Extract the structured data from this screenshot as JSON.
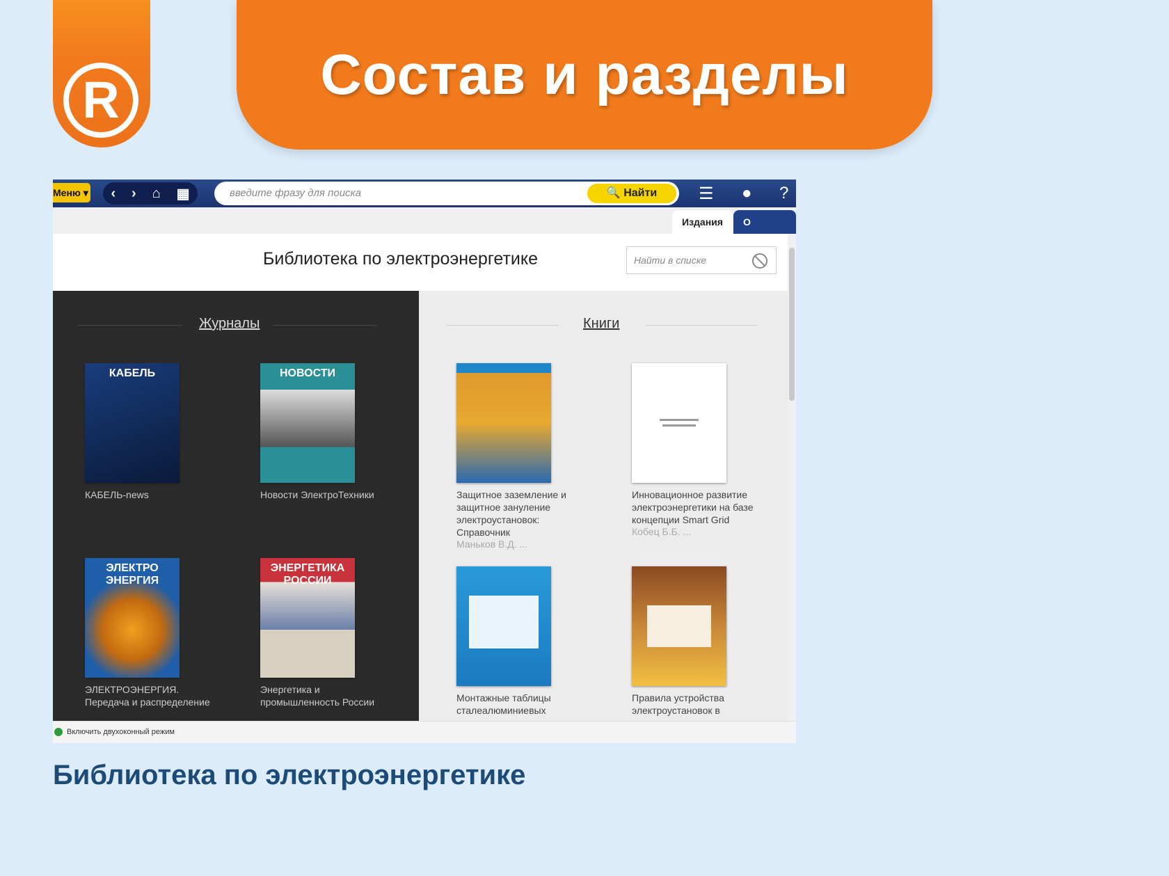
{
  "slide_title": "Состав и разделы",
  "logo_letter": "R",
  "screenshot": {
    "menu_label": "Меню",
    "search_placeholder": "введите фразу для поиска",
    "find_button": "Найти",
    "tabs": [
      "Издания",
      "О разделе"
    ],
    "library_title": "Библиотека по электроэнергетике",
    "filter_placeholder": "Найти в списке",
    "journals_title": "Журналы",
    "books_title": "Книги",
    "journals": [
      {
        "title": "КАБЕЛЬ-news",
        "cover_text": "КАБЕЛЬ",
        "cover_color": "#1a3d7c"
      },
      {
        "title": "Новости ЭлектроТехники",
        "cover_text": "НОВОСТИ",
        "cover_color": "#2a8f96"
      },
      {
        "title": "ЭЛЕКТРОЭНЕРГИЯ. Передача и распределение",
        "cover_text": "ЭЛЕКТРО ЭНЕРГИЯ",
        "cover_color": "#1f5ea8"
      },
      {
        "title": "Энергетика и промышленность России",
        "cover_text": "ЭНЕРГЕТИКА РОССИИ",
        "cover_color": "#c8323a"
      }
    ],
    "books": [
      {
        "title": "Защитное заземление и защитное зануление электроустановок: Справочник",
        "author": "Маньков В.Д. ...",
        "cover_color": "#1d86c8"
      },
      {
        "title": "Инновационное развитие электроэнергетики на базе концепции Smart Grid",
        "author": "Кобец Б.Б. ...",
        "cover_color": "#ffffff"
      },
      {
        "title": "Монтажные таблицы сталеалюминиевых",
        "author": "",
        "cover_color": "#2a9ad8"
      },
      {
        "title": "Правила устройства электроустановок в",
        "author": "",
        "cover_color": "#c9873a"
      }
    ],
    "status_text": "Включить двухоконный режим"
  },
  "bottom_caption": "Библиотека по электроэнергетике"
}
